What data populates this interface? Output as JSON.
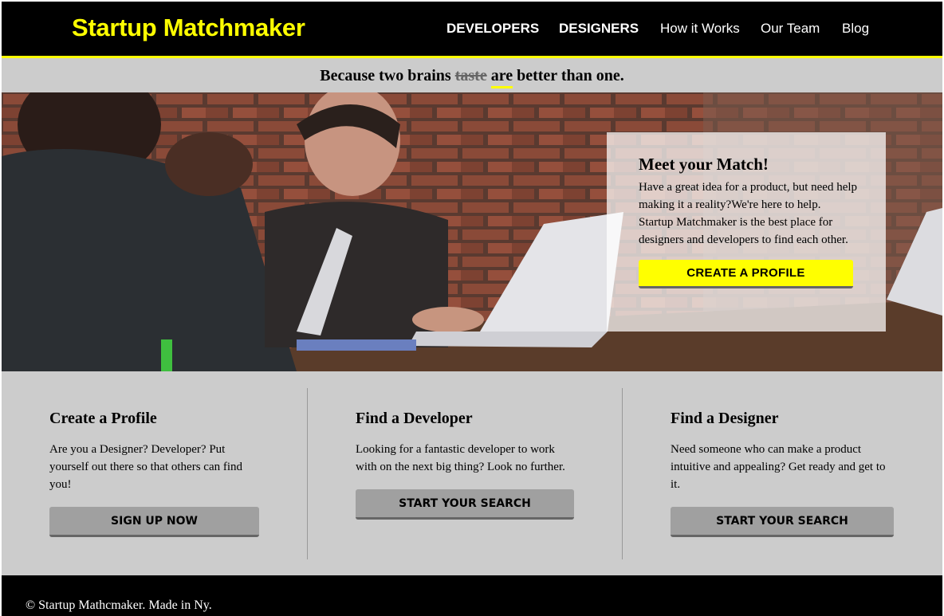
{
  "header": {
    "logo": "Startup Matchmaker",
    "nav": [
      "DEVELOPERS",
      "DESIGNERS",
      "How it Works",
      "Our Team",
      "Blog"
    ]
  },
  "tagline": {
    "before": "Because two brains ",
    "struck": "taste",
    "highlight": "are",
    "after": " better than one."
  },
  "hero": {
    "card_title": "Meet your Match!",
    "card_text": "Have a great idea for a product, but need help making it a reality?We're here to help. Startup Matchmaker is the best place for designers and developers to find each other.",
    "cta": "CREATE A PROFILE"
  },
  "features": [
    {
      "title": "Create a Profile",
      "text": "Are you a Designer? Developer? Put yourself out there so that others can find you!",
      "button": "SIGN UP NOW"
    },
    {
      "title": "Find a Developer",
      "text": "Looking for a fantastic developer to work with on the next big thing? Look no further.",
      "button": "START YOUR SEARCH"
    },
    {
      "title": "Find a Designer",
      "text": "Need someone who can make a product intuitive and appealing? Get ready and get to it.",
      "button": "START YOUR SEARCH"
    }
  ],
  "footer": {
    "text": "© Startup Mathcmaker. Made in Ny."
  },
  "colors": {
    "accent": "#ffff00",
    "header_bg": "#000000",
    "body_bg": "#cccccc",
    "button_gray": "#a0a0a0"
  }
}
